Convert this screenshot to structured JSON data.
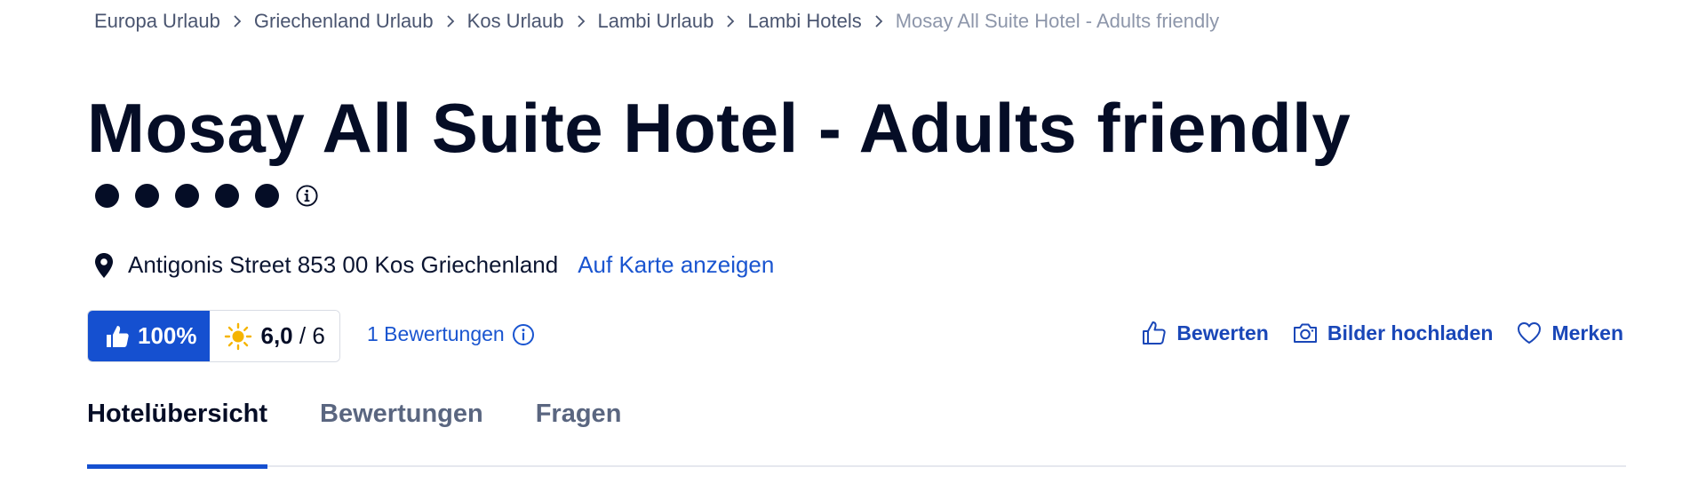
{
  "breadcrumb": {
    "items": [
      {
        "label": "Europa Urlaub"
      },
      {
        "label": "Griechenland Urlaub"
      },
      {
        "label": "Kos Urlaub"
      },
      {
        "label": "Lambi Urlaub"
      },
      {
        "label": "Lambi Hotels"
      },
      {
        "label": "Mosay All Suite Hotel - Adults friendly"
      }
    ]
  },
  "hotel": {
    "name": "Mosay All Suite Hotel - Adults friendly",
    "stars": 5,
    "address": "Antigonis Street 853 00 Kos Griechenland",
    "map_link": "Auf Karte anzeigen"
  },
  "rating": {
    "recommend": "100%",
    "score": "6,0",
    "score_max": "/ 6",
    "reviews_link": "1 Bewertungen"
  },
  "actions": {
    "rate": "Bewerten",
    "upload": "Bilder hochladen",
    "save": "Merken"
  },
  "tabs": [
    {
      "label": "Hotelübersicht",
      "active": true
    },
    {
      "label": "Bewertungen",
      "active": false
    },
    {
      "label": "Fragen",
      "active": false
    }
  ],
  "colors": {
    "accent": "#1550d0",
    "link": "#1a55d0",
    "text": "#050d26",
    "sun": "#f5b400"
  },
  "icons": [
    "chevron-right-icon",
    "info-icon",
    "location-pin-icon",
    "thumbs-up-icon",
    "sun-icon",
    "camera-icon",
    "heart-icon"
  ]
}
